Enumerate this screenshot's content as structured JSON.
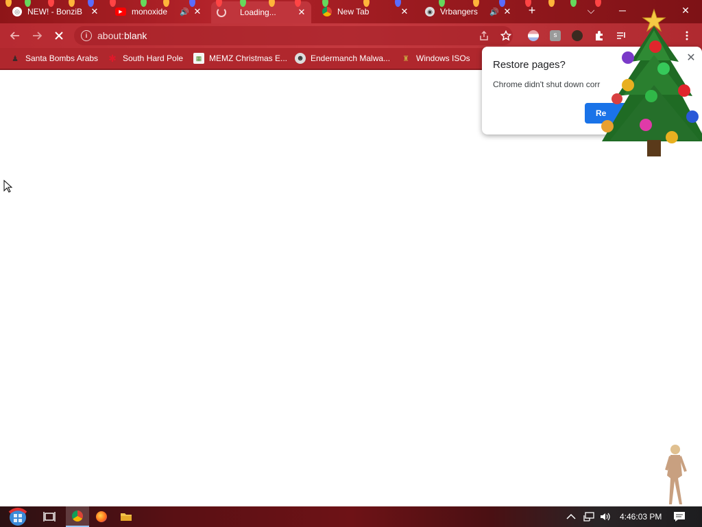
{
  "colors": {
    "tab_strip": "#9a1a1f",
    "active_tab": "#c0353c",
    "toolbar": "#c0353c",
    "dialog_button": "#1a73e8"
  },
  "tabs": [
    {
      "title": "NEW! - BonziB",
      "icon": "globe-icon",
      "close": "✕",
      "audio": false,
      "active": false
    },
    {
      "title": "monoxide",
      "icon": "youtube-icon",
      "close": "✕",
      "audio": true,
      "active": false
    },
    {
      "title": "Loading...",
      "icon": "loading-icon",
      "close": "✕",
      "audio": false,
      "active": true
    },
    {
      "title": "New Tab",
      "icon": "chrome-icon",
      "close": "✕",
      "audio": false,
      "active": false
    },
    {
      "title": "Vrbangers",
      "icon": "vr-icon",
      "close": "✕",
      "audio": true,
      "active": false
    }
  ],
  "new_tab_label": "+",
  "window_controls": {
    "tab_search": "⌵",
    "minimize": "─",
    "close": "✕"
  },
  "address": {
    "scheme": "about:",
    "path": "blank"
  },
  "bookmarks": [
    {
      "label": "Santa Bombs Arabs",
      "icon": "santa-icon"
    },
    {
      "label": "South Hard Pole",
      "icon": "snowflake-icon"
    },
    {
      "label": "MEMZ Christmas E...",
      "icon": "memz-icon"
    },
    {
      "label": "Endermanch Malwa...",
      "icon": "raccoon-icon"
    },
    {
      "label": "Windows ISOs",
      "icon": "folder-icon"
    }
  ],
  "dialog": {
    "title": "Restore pages?",
    "message": "Chrome didn't shut down corr",
    "button": "Re"
  },
  "taskbar": {
    "time": "4:46:03 PM",
    "apps": [
      "task-view-icon",
      "chrome-icon",
      "firefox-icon",
      "file-explorer-icon"
    ]
  }
}
